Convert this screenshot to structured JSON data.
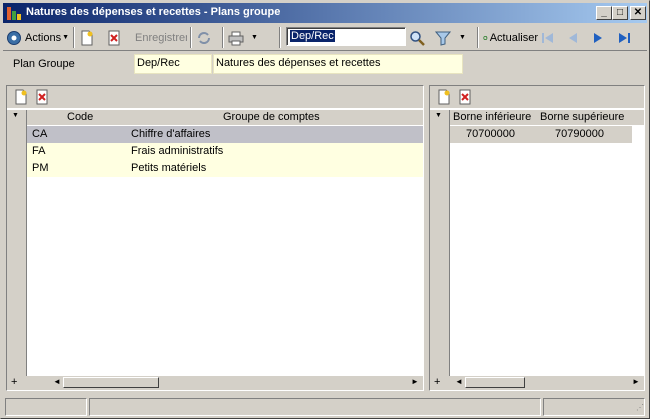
{
  "window": {
    "title": "Natures des dépenses et recettes - Plans groupe"
  },
  "toolbar": {
    "actions_label": "Actions",
    "save_label": "Enregistrer",
    "search_value": "Dep/Rec",
    "refresh_label": "Actualiser"
  },
  "header": {
    "label": "Plan Groupe",
    "code": "Dep/Rec",
    "name": "Natures des dépenses et recettes"
  },
  "left_grid": {
    "columns": [
      "Code",
      "Groupe de comptes"
    ],
    "rows": [
      {
        "code": "CA",
        "group": "Chiffre d'affaires"
      },
      {
        "code": "FA",
        "group": "Frais administratifs"
      },
      {
        "code": "PM",
        "group": "Petits matériels"
      }
    ]
  },
  "right_grid": {
    "columns": [
      "Borne inférieure",
      "Borne supérieure"
    ],
    "rows": [
      {
        "low": "70700000",
        "high": "70790000"
      }
    ]
  }
}
